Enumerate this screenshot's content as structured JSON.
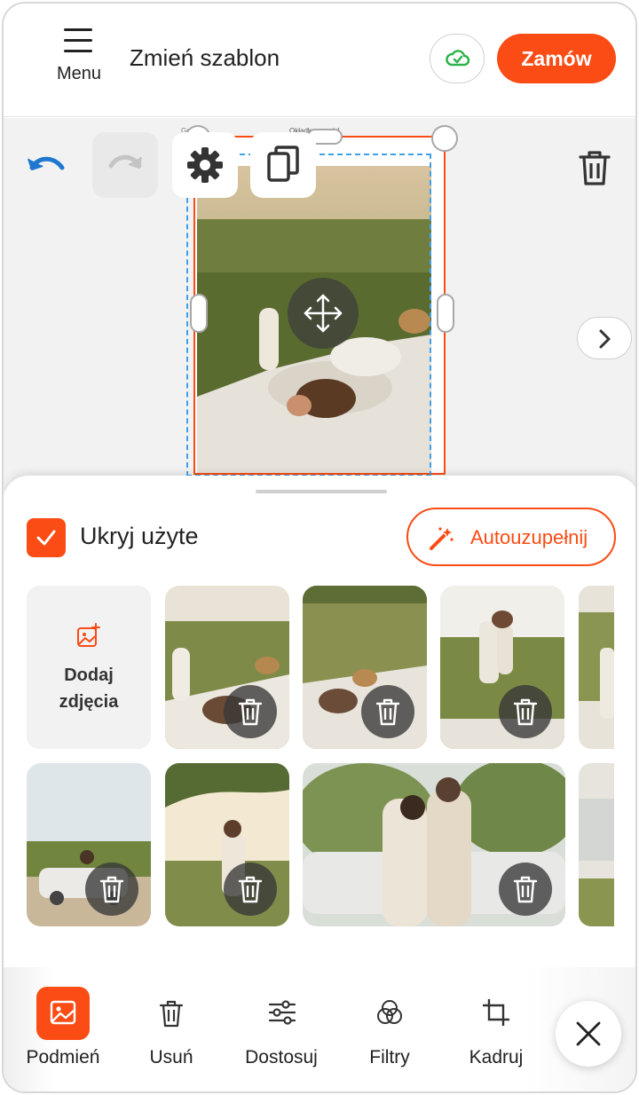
{
  "header": {
    "menu_label": "Menu",
    "title": "Zmień szablon",
    "order_label": "Zamów"
  },
  "canvas": {
    "page_label_right": "Okładka - przód",
    "page_label_left": "Gr..."
  },
  "panel": {
    "hide_used_label": "Ukryj użyte",
    "hide_used_checked": true,
    "autofill_label": "Autouzupełnij",
    "add_photos_label_line1": "Dodaj",
    "add_photos_label_line2": "zdjęcia"
  },
  "toolbar": {
    "items": [
      {
        "label": "Podmień",
        "icon": "image-icon",
        "active": true
      },
      {
        "label": "Usuń",
        "icon": "trash-icon",
        "active": false
      },
      {
        "label": "Dostosuj",
        "icon": "sliders-icon",
        "active": false
      },
      {
        "label": "Filtry",
        "icon": "filters-icon",
        "active": false
      },
      {
        "label": "Kadruj",
        "icon": "crop-icon",
        "active": false
      }
    ]
  },
  "colors": {
    "accent": "#fa4c14",
    "selection": "#3ea0e8",
    "undo_blue": "#1e78d2",
    "cloud_green": "#2db34a"
  }
}
